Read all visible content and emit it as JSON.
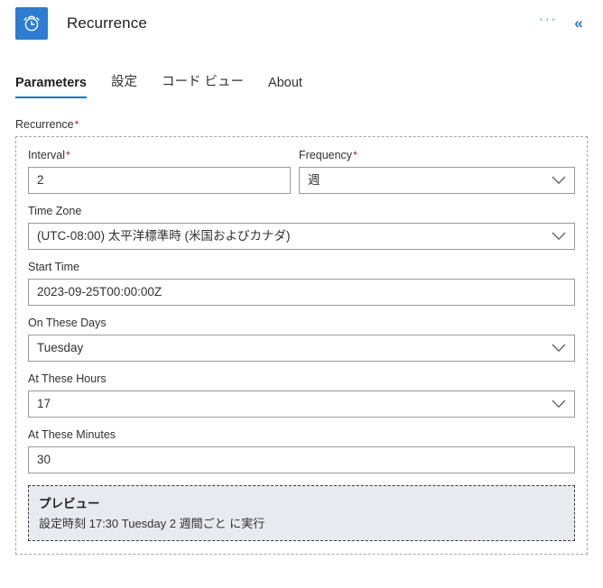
{
  "header": {
    "icon_name": "alarm-clock-icon",
    "title": "Recurrence",
    "more_label": "···",
    "collapse_label": "«",
    "accent_color": "#2b7cd3"
  },
  "tabs": [
    {
      "label": "Parameters",
      "active": true
    },
    {
      "label": "設定",
      "active": false
    },
    {
      "label": "コード ビュー",
      "active": false
    },
    {
      "label": "About",
      "active": false
    }
  ],
  "section": {
    "label": "Recurrence",
    "required_mark": "*"
  },
  "fields": {
    "interval": {
      "label": "Interval",
      "required_mark": "*",
      "value": "2",
      "type": "text"
    },
    "frequency": {
      "label": "Frequency",
      "required_mark": "*",
      "value": "週",
      "type": "dropdown"
    },
    "time_zone": {
      "label": "Time Zone",
      "value": "(UTC-08:00) 太平洋標準時 (米国およびカナダ)",
      "type": "dropdown"
    },
    "start_time": {
      "label": "Start Time",
      "value": "2023-09-25T00:00:00Z",
      "type": "text"
    },
    "on_these_days": {
      "label": "On These Days",
      "value": "Tuesday",
      "type": "dropdown"
    },
    "at_these_hours": {
      "label": "At These Hours",
      "value": "17",
      "type": "dropdown"
    },
    "at_these_minutes": {
      "label": "At These Minutes",
      "value": "30",
      "type": "text"
    }
  },
  "preview": {
    "title": "プレビュー",
    "text": "設定時刻 17:30 Tuesday 2 週間ごと に実行",
    "background_color": "#e9e9f0"
  }
}
